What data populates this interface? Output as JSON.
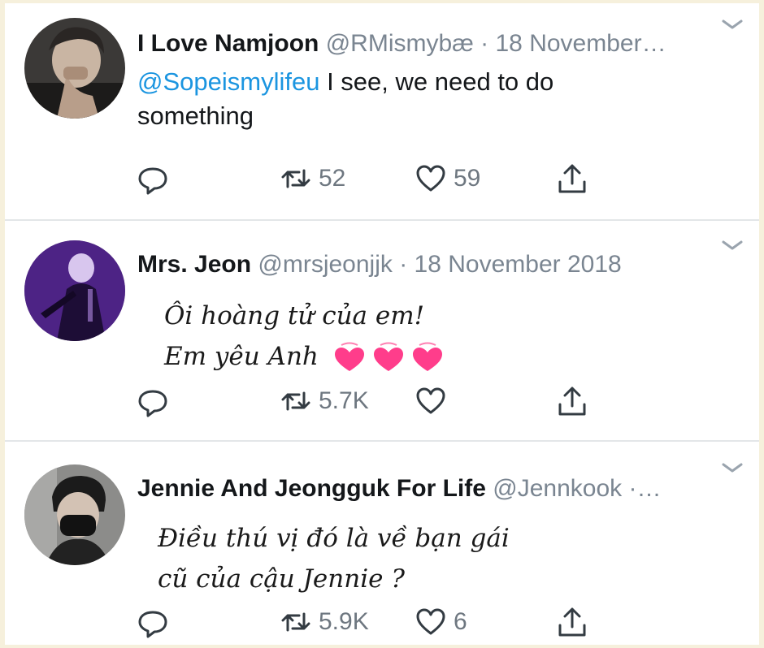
{
  "tweets": [
    {
      "name": "I Love Namjoon",
      "handle": "@RMismybæ",
      "date": "· 18 November…",
      "mention": "@Sopeismylifeu",
      "text": " I see, we need to do something",
      "replies": "",
      "retweets": "52",
      "likes": "59"
    },
    {
      "name": "Mrs. Jeon",
      "handle": "@mrsjeonjjk",
      "date": "· 18 November 2018",
      "handwritten_line1": "Ôi hoàng tử của em!",
      "handwritten_line2": "Em yêu Anh",
      "replies": "",
      "retweets": "5.7K",
      "likes": ""
    },
    {
      "name": "Jennie And Jeongguk For Life",
      "handle": "@Jennkook",
      "date": "·…",
      "handwritten_line1": "Điều thú vị đó là về bạn gái",
      "handwritten_line2": "cũ của cậu Jennie ?",
      "replies": "",
      "retweets": "5.9K",
      "likes": "6"
    }
  ],
  "colors": {
    "background": "#f6f0dc",
    "text": "#14171a",
    "secondary": "#7a8591",
    "link": "#1b95e0",
    "heart_pink": "#ff3d8b"
  },
  "icons": [
    "reply-icon",
    "retweet-icon",
    "like-icon",
    "share-icon",
    "chevron-down-icon",
    "two-hearts-icon"
  ]
}
